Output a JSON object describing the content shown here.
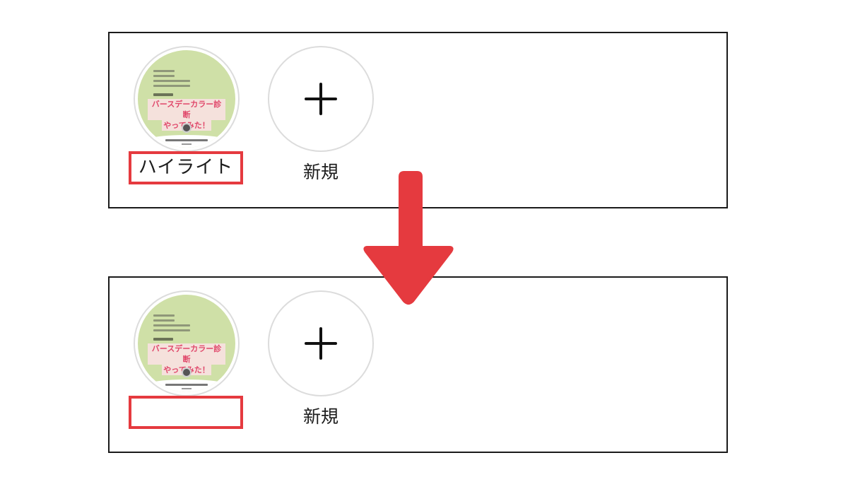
{
  "before": {
    "highlight": {
      "cover_banner_line1": "バースデーカラー診断",
      "cover_banner_line2": "やってみた！",
      "label": "ハイライト"
    },
    "new_button": {
      "label": "新規",
      "icon": "plus-icon"
    }
  },
  "after": {
    "highlight": {
      "cover_banner_line1": "バースデーカラー診断",
      "cover_banner_line2": "やってみた！",
      "label": ""
    },
    "new_button": {
      "label": "新規",
      "icon": "plus-icon"
    }
  },
  "colors": {
    "emphasis_red": "#e53a3f",
    "cover_green": "#cfe0a7",
    "banner_pink": "#e0476a"
  },
  "icons": {
    "arrow": "down-arrow-icon",
    "plus": "plus-icon"
  }
}
